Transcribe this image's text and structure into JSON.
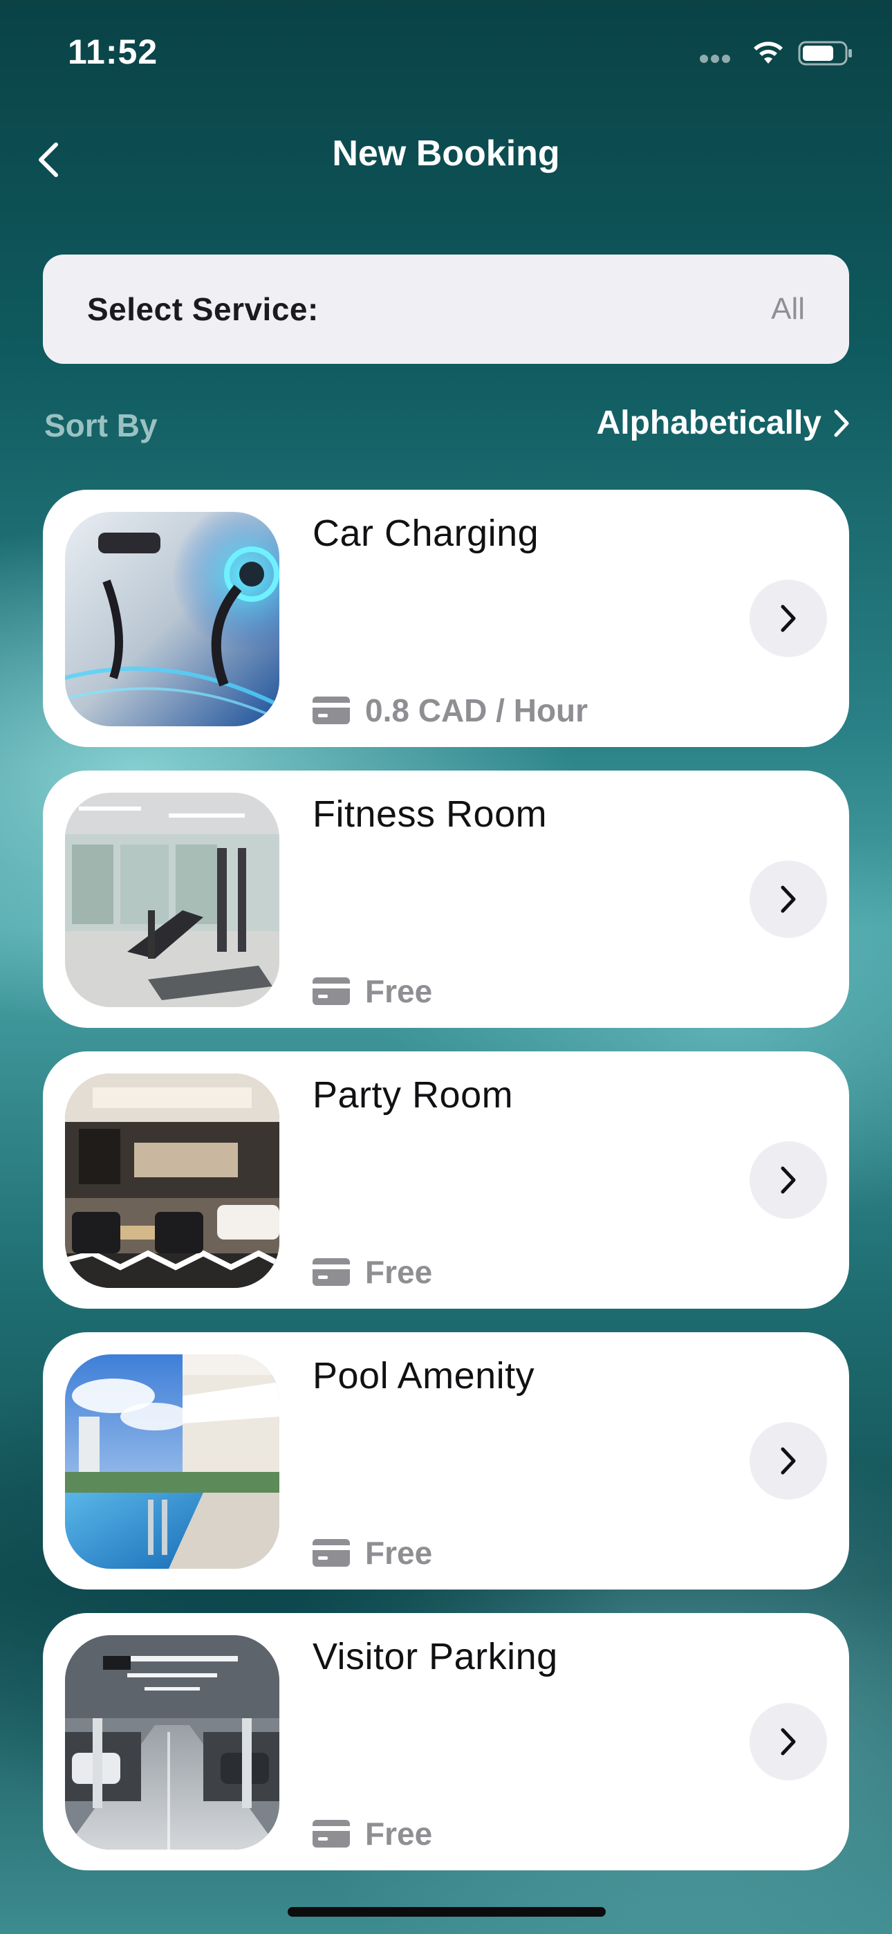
{
  "status_bar": {
    "time": "11:52",
    "icons": [
      "cellular-signal-icon",
      "wifi-icon",
      "battery-icon"
    ]
  },
  "header": {
    "title": "New Booking",
    "back_icon": "chevron-left-icon"
  },
  "service_filter": {
    "label": "Select Service:",
    "value": "All"
  },
  "sort": {
    "label": "Sort By",
    "value": "Alphabetically",
    "icon": "chevron-right-icon"
  },
  "services": [
    {
      "name": "Car Charging",
      "price": "0.8 CAD / Hour",
      "image": "ev-charger-photo"
    },
    {
      "name": "Fitness Room",
      "price": "Free",
      "image": "gym-photo"
    },
    {
      "name": "Party Room",
      "price": "Free",
      "image": "lounge-photo"
    },
    {
      "name": "Pool Amenity",
      "price": "Free",
      "image": "pool-photo"
    },
    {
      "name": "Visitor Parking",
      "price": "Free",
      "image": "parking-garage-photo"
    }
  ],
  "colors": {
    "background_dark": "#0a4246",
    "background_light": "#4aa3a6",
    "card_background": "#ffffff",
    "price_gray": "#8e8e93",
    "select_background": "#f0f0f4"
  }
}
